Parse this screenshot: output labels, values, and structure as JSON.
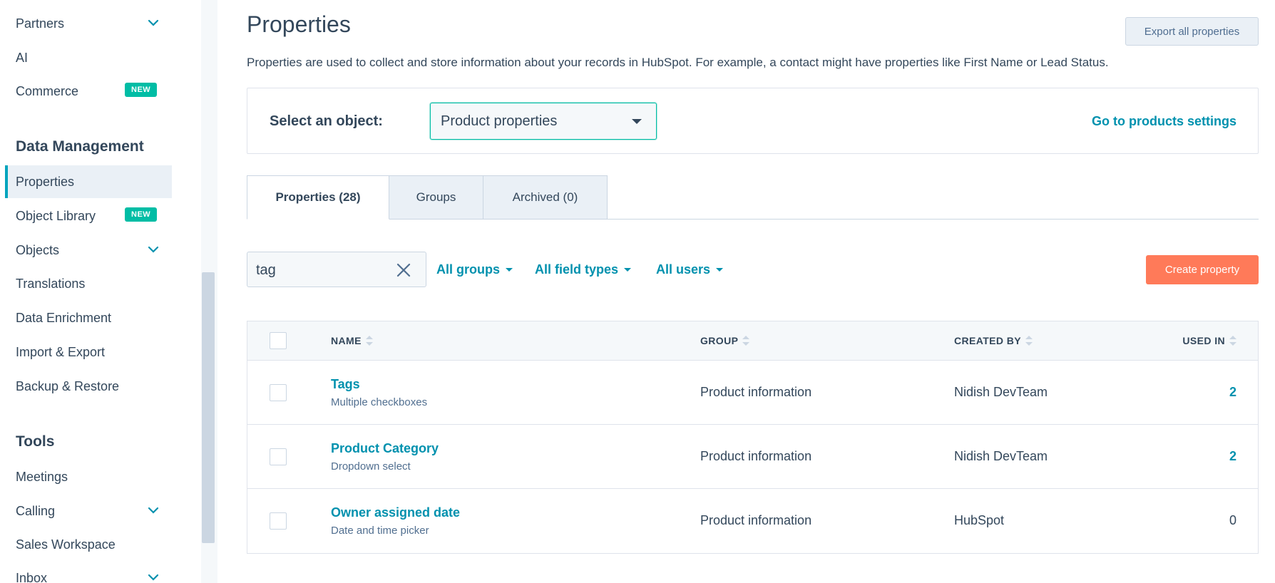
{
  "sidebar": {
    "items_top": [
      {
        "label": "Partners",
        "has_chevron": true
      },
      {
        "label": "AI"
      },
      {
        "label": "Commerce",
        "badge": "NEW"
      }
    ],
    "section_data_management": "Data Management",
    "data_management_items": [
      {
        "label": "Properties",
        "active": true
      },
      {
        "label": "Object Library",
        "badge": "NEW"
      },
      {
        "label": "Objects",
        "has_chevron": true
      },
      {
        "label": "Translations"
      },
      {
        "label": "Data Enrichment"
      },
      {
        "label": "Import & Export"
      },
      {
        "label": "Backup & Restore"
      }
    ],
    "section_tools": "Tools",
    "tools_items": [
      {
        "label": "Meetings"
      },
      {
        "label": "Calling",
        "has_chevron": true
      },
      {
        "label": "Sales Workspace"
      },
      {
        "label": "Inbox",
        "has_chevron": true
      }
    ]
  },
  "header": {
    "title": "Properties",
    "export_label": "Export all properties",
    "description": "Properties are used to collect and store information about your records in HubSpot. For example, a contact might have properties like First Name or Lead Status."
  },
  "object_selector": {
    "label": "Select an object:",
    "selected": "Product properties",
    "settings_link": "Go to products settings"
  },
  "tabs": [
    {
      "label": "Properties (28)",
      "active": true
    },
    {
      "label": "Groups"
    },
    {
      "label": "Archived (0)"
    }
  ],
  "filters": {
    "search_value": "tag",
    "groups": "All groups",
    "field_types": "All field types",
    "users": "All users",
    "create_label": "Create property"
  },
  "table": {
    "columns": {
      "name": "NAME",
      "group": "GROUP",
      "created_by": "CREATED BY",
      "used_in": "USED IN"
    },
    "rows": [
      {
        "name": "Tags",
        "type": "Multiple checkboxes",
        "group": "Product information",
        "created_by": "Nidish DevTeam",
        "used_in": "2"
      },
      {
        "name": "Product Category",
        "type": "Dropdown select",
        "group": "Product information",
        "created_by": "Nidish DevTeam",
        "used_in": "2"
      },
      {
        "name": "Owner assigned date",
        "type": "Date and time picker",
        "group": "Product information",
        "created_by": "HubSpot",
        "used_in": "0"
      }
    ]
  },
  "colors": {
    "accent": "#0091ae",
    "primary_button": "#ff7a59",
    "badge": "#00bda5",
    "text": "#33475b"
  }
}
